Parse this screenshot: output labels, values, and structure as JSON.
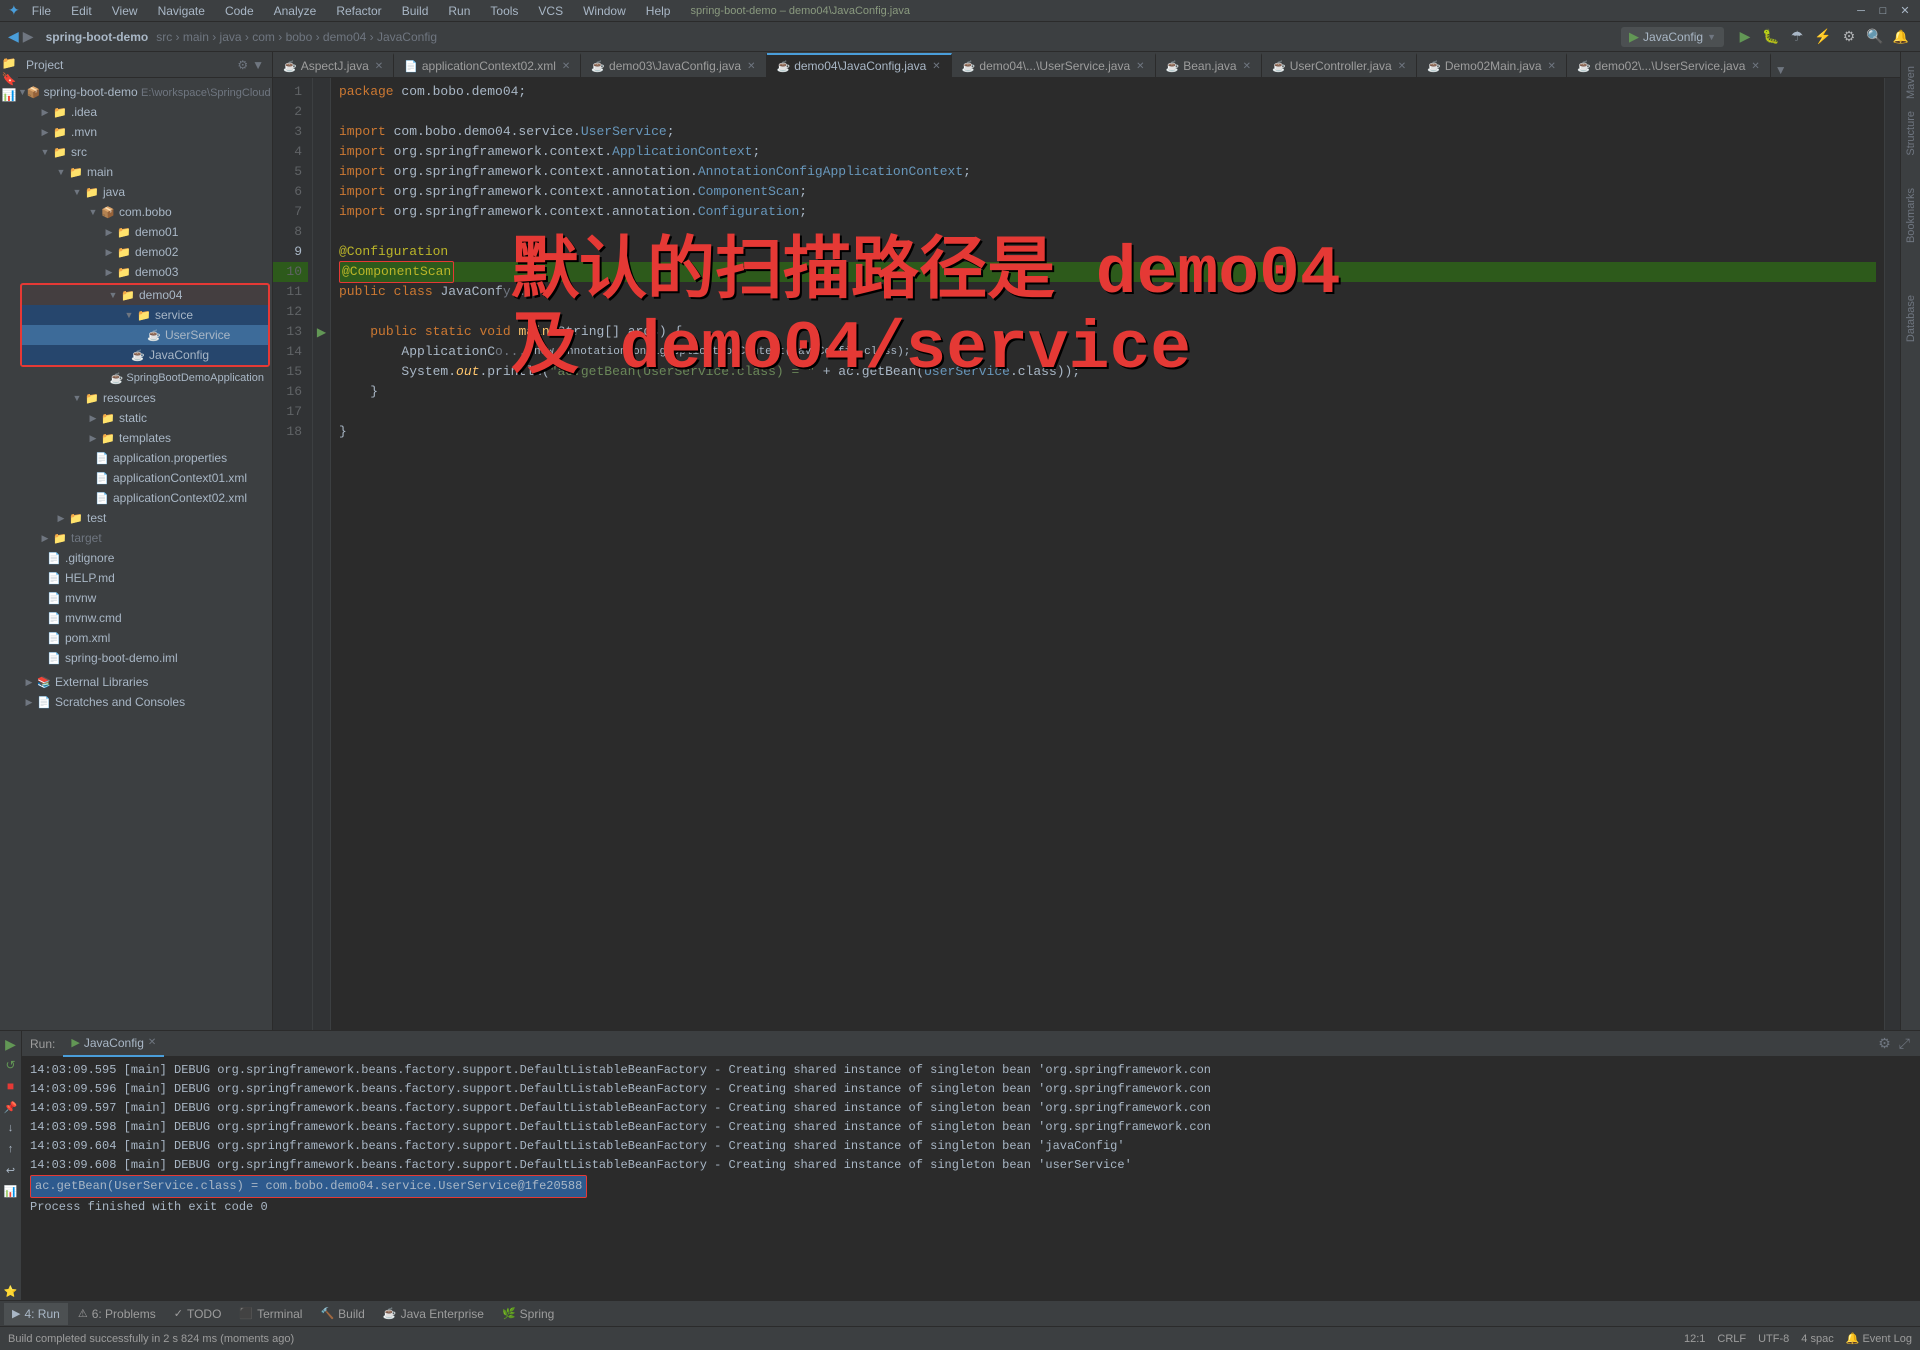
{
  "window": {
    "title": "spring-boot-demo – demo04\\JavaConfig.java",
    "menu": [
      "File",
      "Edit",
      "View",
      "Navigate",
      "Code",
      "Analyze",
      "Refactor",
      "Build",
      "Run",
      "Tools",
      "VCS",
      "Window",
      "Help"
    ]
  },
  "toolbar": {
    "project_name": "spring-boot-demo",
    "breadcrumb": "src › main › java › com › bobo › demo04 › JavaConfig",
    "run_config": "JavaConfig"
  },
  "project_panel": {
    "title": "Project",
    "items": [
      {
        "id": "spring-boot-demo",
        "label": "spring-boot-demo E:\\workspace\\SpringCloud",
        "level": 0,
        "type": "root",
        "expanded": true
      },
      {
        "id": "idea",
        "label": ".idea",
        "level": 1,
        "type": "folder",
        "expanded": false
      },
      {
        "id": "mvn",
        "label": ".mvn",
        "level": 1,
        "type": "folder",
        "expanded": false
      },
      {
        "id": "src",
        "label": "src",
        "level": 1,
        "type": "folder",
        "expanded": true
      },
      {
        "id": "main",
        "label": "main",
        "level": 2,
        "type": "folder",
        "expanded": true
      },
      {
        "id": "java",
        "label": "java",
        "level": 3,
        "type": "folder",
        "expanded": true
      },
      {
        "id": "com.bobo",
        "label": "com.bobo",
        "level": 4,
        "type": "package",
        "expanded": true
      },
      {
        "id": "demo01",
        "label": "demo01",
        "level": 5,
        "type": "folder",
        "expanded": false
      },
      {
        "id": "demo02",
        "label": "demo02",
        "level": 5,
        "type": "folder",
        "expanded": false
      },
      {
        "id": "demo03",
        "label": "demo03",
        "level": 5,
        "type": "folder",
        "expanded": false
      },
      {
        "id": "demo04",
        "label": "demo04",
        "level": 5,
        "type": "folder",
        "expanded": true
      },
      {
        "id": "service",
        "label": "service",
        "level": 6,
        "type": "folder",
        "expanded": true,
        "highlight": true
      },
      {
        "id": "UserService",
        "label": "UserService",
        "level": 7,
        "type": "java-class",
        "highlight": true
      },
      {
        "id": "JavaConfig",
        "label": "JavaConfig",
        "level": 6,
        "type": "java-config",
        "selected": true
      },
      {
        "id": "SpringBootDemoApplication",
        "label": "SpringBootDemoApplication",
        "level": 5,
        "type": "java-class"
      },
      {
        "id": "resources",
        "label": "resources",
        "level": 3,
        "type": "folder",
        "expanded": true
      },
      {
        "id": "static",
        "label": "static",
        "level": 4,
        "type": "folder",
        "expanded": false
      },
      {
        "id": "templates",
        "label": "templates",
        "level": 4,
        "type": "folder",
        "expanded": false
      },
      {
        "id": "application.properties",
        "label": "application.properties",
        "level": 4,
        "type": "properties"
      },
      {
        "id": "applicationContext01.xml",
        "label": "applicationContext01.xml",
        "level": 4,
        "type": "xml"
      },
      {
        "id": "applicationContext02.xml",
        "label": "applicationContext02.xml",
        "level": 4,
        "type": "xml"
      },
      {
        "id": "test",
        "label": "test",
        "level": 2,
        "type": "folder",
        "expanded": false
      },
      {
        "id": "target",
        "label": "target",
        "level": 1,
        "type": "folder",
        "expanded": false
      },
      {
        "id": ".gitignore",
        "label": ".gitignore",
        "level": 1,
        "type": "file"
      },
      {
        "id": "HELP.md",
        "label": "HELP.md",
        "level": 1,
        "type": "md"
      },
      {
        "id": "mvnw",
        "label": "mvnw",
        "level": 1,
        "type": "file"
      },
      {
        "id": "mvnw.cmd",
        "label": "mvnw.cmd",
        "level": 1,
        "type": "file"
      },
      {
        "id": "pom.xml",
        "label": "pom.xml",
        "level": 1,
        "type": "xml"
      },
      {
        "id": "spring-boot-demo.iml",
        "label": "spring-boot-demo.iml",
        "level": 1,
        "type": "iml"
      }
    ],
    "extra_sections": [
      {
        "label": "External Libraries"
      },
      {
        "label": "Scratches and Consoles"
      }
    ]
  },
  "editor_tabs": [
    {
      "label": "AspectJ.java",
      "active": false,
      "modified": false
    },
    {
      "label": "applicationContext02.xml",
      "active": false,
      "modified": false
    },
    {
      "label": "demo03\\JavaConfig.java",
      "active": false,
      "modified": false
    },
    {
      "label": "demo04\\JavaConfig.java",
      "active": true,
      "modified": false
    },
    {
      "label": "demo04\\...\\UserService.java",
      "active": false,
      "modified": false
    },
    {
      "label": "Bean.java",
      "active": false,
      "modified": false
    },
    {
      "label": "UserController.java",
      "active": false,
      "modified": false
    },
    {
      "label": "Demo02Main.java",
      "active": false,
      "modified": false
    },
    {
      "label": "demo02\\...\\UserService.java",
      "active": false,
      "modified": false
    }
  ],
  "code": {
    "package_line": "package com.bobo.demo04;",
    "lines": [
      {
        "num": 1,
        "text": "package com.bobo.demo04;"
      },
      {
        "num": 2,
        "text": ""
      },
      {
        "num": 3,
        "text": "import com.bobo.demo04.service.UserService;"
      },
      {
        "num": 4,
        "text": "import org.springframework.context.ApplicationContext;"
      },
      {
        "num": 5,
        "text": "import org.springframework.context.annotation.AnnotationConfigApplicationContext;"
      },
      {
        "num": 6,
        "text": "import org.springframework.context.annotation.ComponentScan;"
      },
      {
        "num": 7,
        "text": "import org.springframework.context.annotation.Configuration;"
      },
      {
        "num": 8,
        "text": ""
      },
      {
        "num": 9,
        "text": "@Configuration"
      },
      {
        "num": 10,
        "text": "@ComponentScan"
      },
      {
        "num": 11,
        "text": "public class JavaConfig {"
      },
      {
        "num": 12,
        "text": ""
      },
      {
        "num": 13,
        "text": "    public static void main(String[] args) {"
      },
      {
        "num": 14,
        "text": "        ApplicationContext ac = new AnnotationConfigApplicationContext(JavaConfig.class);"
      },
      {
        "num": 15,
        "text": "        System.out.println(\"ac.getBean(UserService.class) = \" + ac.getBean(UserService.class));"
      },
      {
        "num": 16,
        "text": "    }"
      },
      {
        "num": 17,
        "text": ""
      },
      {
        "num": 18,
        "text": "}"
      }
    ]
  },
  "overlay": {
    "line1": "默认的扫描路径是 demo04",
    "line2": "及 demo04/service"
  },
  "console": {
    "run_label": "Run:",
    "config_label": "JavaConfig",
    "lines": [
      {
        "text": "14:03:09.595 [main] DEBUG org.springframework.beans.factory.support.DefaultListableBeanFactory - Creating shared instance of singleton bean 'org.springframework.con"
      },
      {
        "text": "14:03:09.596 [main] DEBUG org.springframework.beans.factory.support.DefaultListableBeanFactory - Creating shared instance of singleton bean 'org.springframework.con"
      },
      {
        "text": "14:03:09.597 [main] DEBUG org.springframework.beans.factory.support.DefaultListableBeanFactory - Creating shared instance of singleton bean 'org.springframework.con"
      },
      {
        "text": "14:03:09.598 [main] DEBUG org.springframework.beans.factory.support.DefaultListableBeanFactory - Creating shared instance of singleton bean 'org.springframework.con"
      },
      {
        "text": "14:03:09.604 [main] DEBUG org.springframework.beans.factory.support.DefaultListableBeanFactory - Creating shared instance of singleton bean 'javaConfig'"
      },
      {
        "text": "14:03:09.608 [main] DEBUG org.springframework.beans.factory.support.DefaultListableBeanFactory - Creating shared instance of singleton bean 'userService'"
      },
      {
        "text": "ac.getBean(UserService.class) = com.bobo.demo04.service.UserService@1fe20588",
        "highlight": true
      },
      {
        "text": ""
      },
      {
        "text": "Process finished with exit code 0"
      }
    ]
  },
  "bottom_tabs": [
    {
      "label": "4: Run",
      "icon": "▶",
      "active": true
    },
    {
      "label": "6: Problems",
      "icon": "⚠",
      "active": false
    },
    {
      "label": "TODO",
      "icon": "✓",
      "active": false
    },
    {
      "label": "Terminal",
      "icon": "⬛",
      "active": false
    },
    {
      "label": "Build",
      "icon": "🔨",
      "active": false
    },
    {
      "label": "Java Enterprise",
      "icon": "☕",
      "active": false
    },
    {
      "label": "Spring",
      "icon": "🌿",
      "active": false
    }
  ],
  "status_bar": {
    "build_status": "Build completed successfully in 2 s 824 ms (moments ago)",
    "position": "12:1",
    "line_ending": "CRLF",
    "encoding": "UTF-8",
    "indent": "4 spac"
  },
  "right_labels": [
    "Maven",
    "Structure",
    "Bookmarks",
    "Database"
  ]
}
